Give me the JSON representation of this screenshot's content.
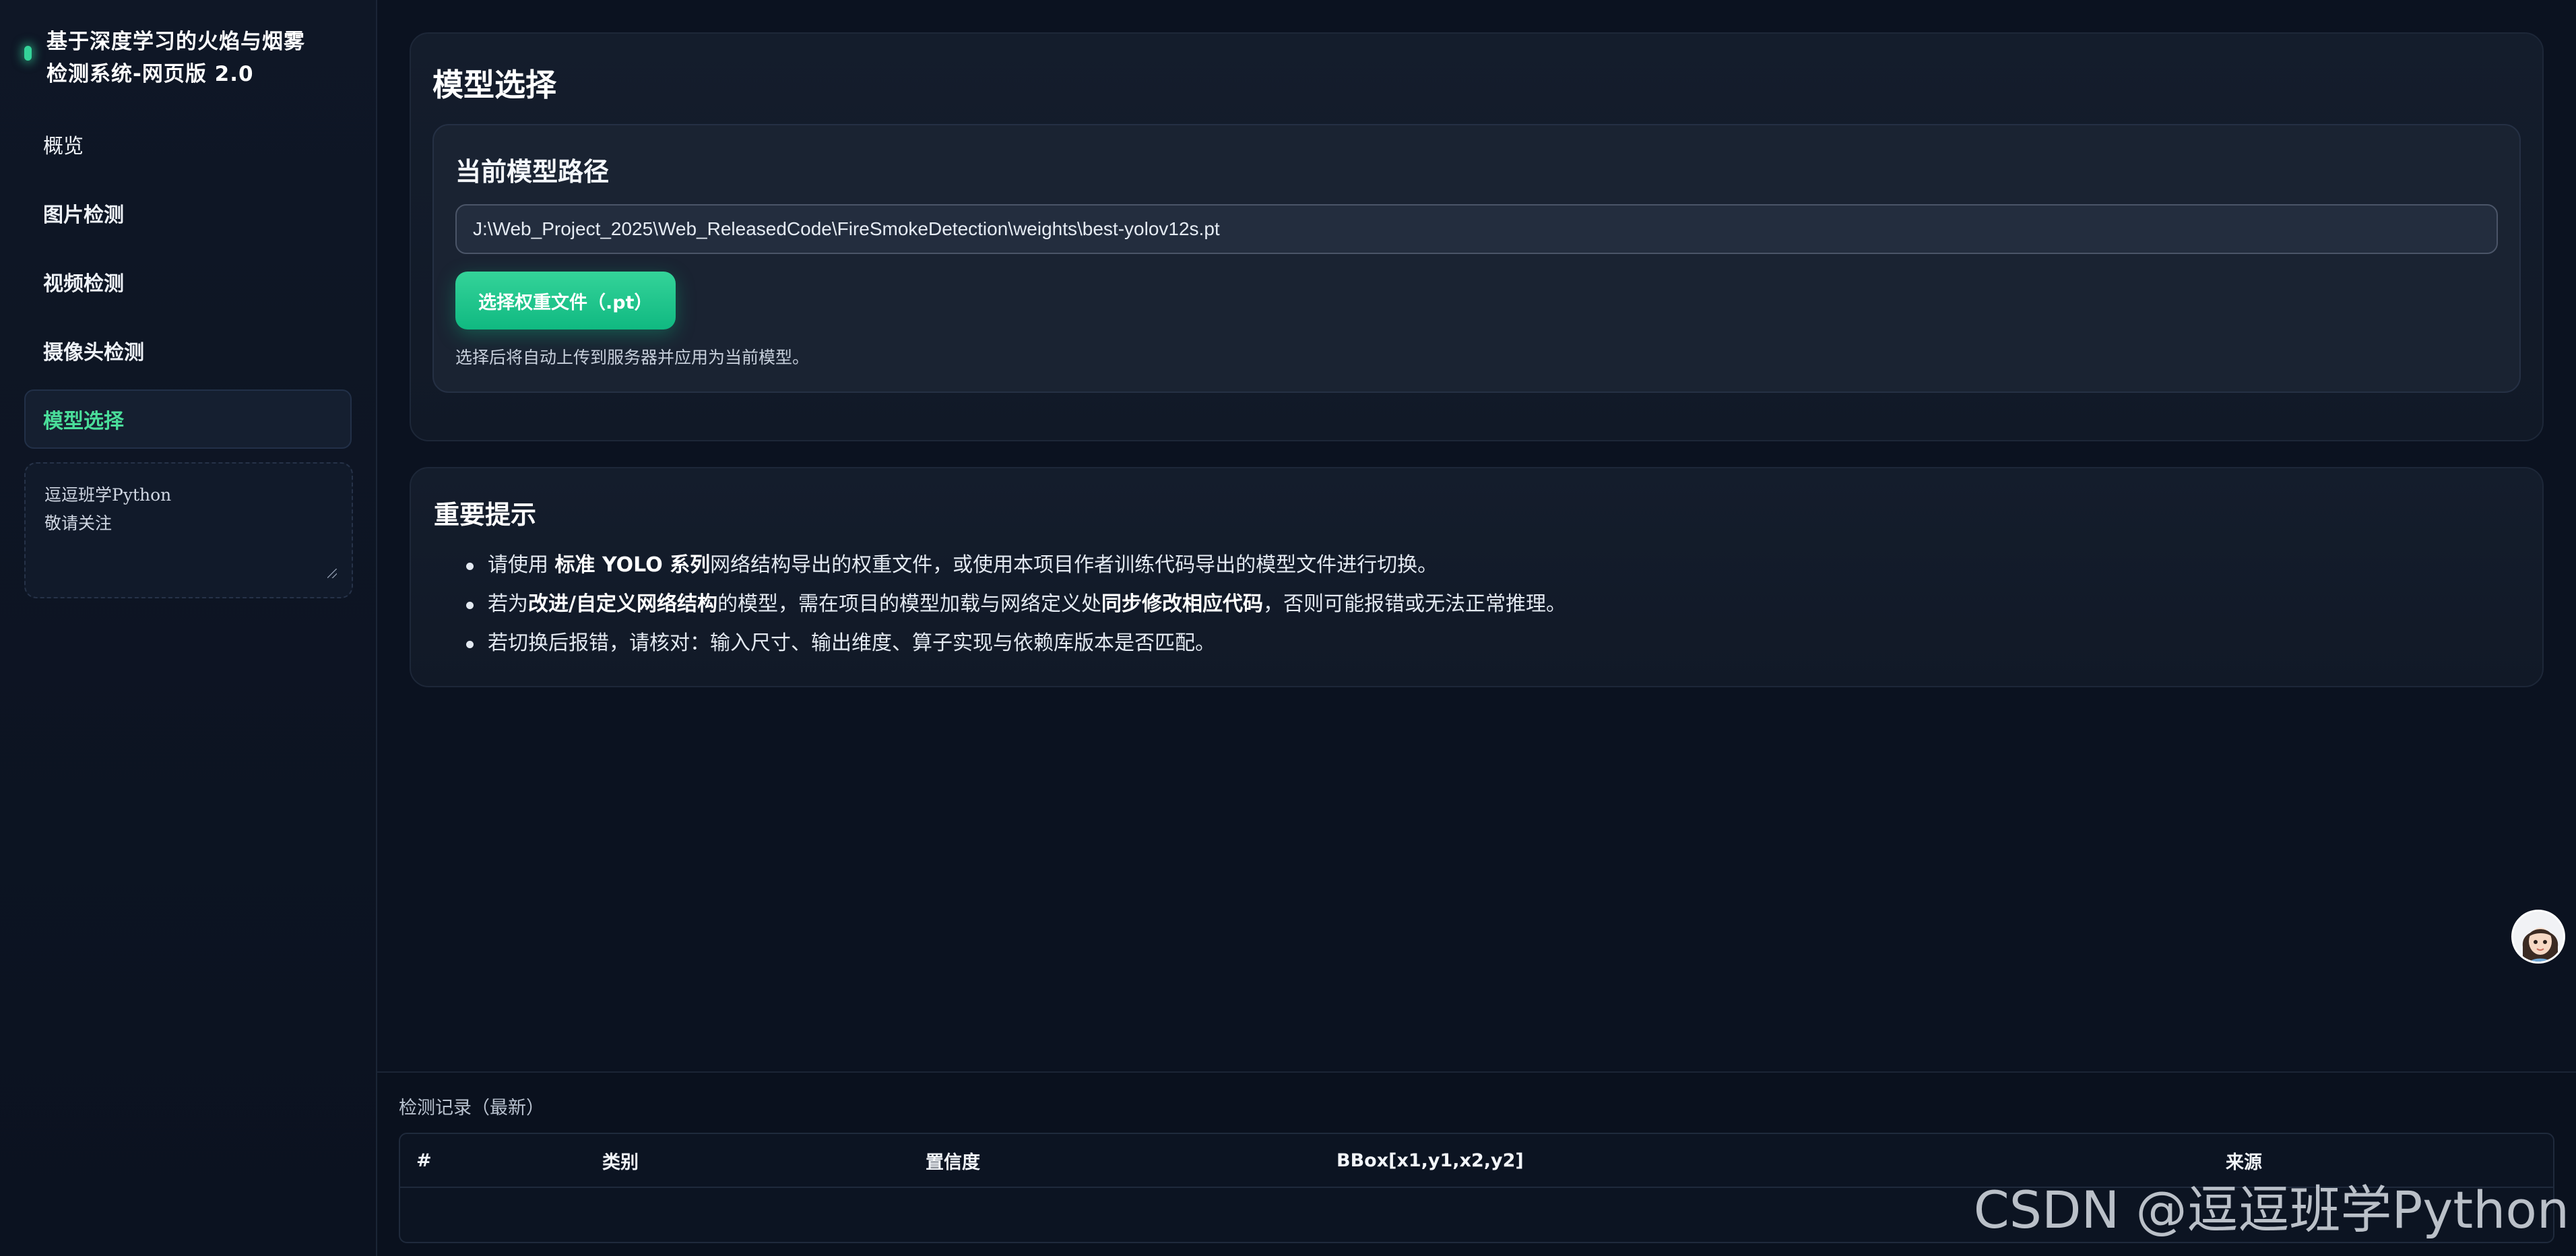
{
  "sidebar": {
    "brand_title_line1": "基于深度学习的火焰与烟雾",
    "brand_title_line2": "检测系统-网页版 2.0",
    "items": [
      {
        "label": "概览"
      },
      {
        "label": "图片检测"
      },
      {
        "label": "视频检测"
      },
      {
        "label": "摄像头检测"
      },
      {
        "label": "模型选择"
      }
    ],
    "note_line1": "逗逗班学Python",
    "note_line2": "敬请关注"
  },
  "model_section": {
    "title": "模型选择",
    "current_path_title": "当前模型路径",
    "path_value": "J:\\Web_Project_2025\\Web_ReleasedCode\\FireSmokeDetection\\weights\\best-yolov12s.pt",
    "choose_button": "选择权重文件（.pt）",
    "hint": "选择后将自动上传到服务器并应用为当前模型。"
  },
  "tips": {
    "title": "重要提示",
    "item1_pre": "请使用 ",
    "item1_bold": "标准 YOLO 系列",
    "item1_post": "网络结构导出的权重文件，或使用本项目作者训练代码导出的模型文件进行切换。",
    "item2_pre": "若为",
    "item2_bold1": "改进/自定义网络结构",
    "item2_mid": "的模型，需在项目的模型加载与网络定义处",
    "item2_bold2": "同步修改相应代码",
    "item2_post": "，否则可能报错或无法正常推理。",
    "item3": "若切换后报错，请核对：输入尺寸、输出维度、算子实现与依赖库版本是否匹配。"
  },
  "records": {
    "label": "检测记录（最新）",
    "columns": [
      "#",
      "类别",
      "置信度",
      "BBox[x1,y1,x2,y2]",
      "来源"
    ]
  },
  "watermark": "CSDN @逗逗班学Python",
  "colors": {
    "accent": "#34d399",
    "active_nav": "#4ade9a",
    "background": "#0b1220"
  }
}
